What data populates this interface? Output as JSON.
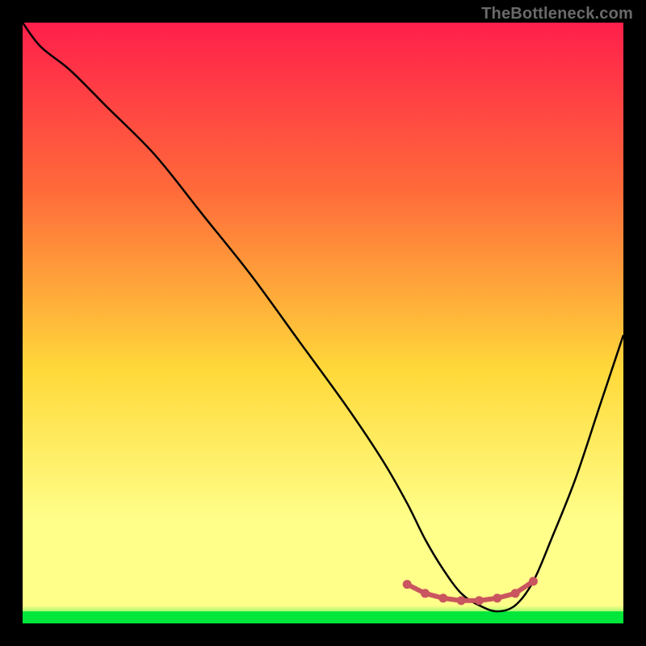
{
  "watermark": "TheBottleneck.com",
  "colors": {
    "background": "#000000",
    "gradient_top": "#ff1f4b",
    "gradient_mid_upper": "#ff6b3a",
    "gradient_mid": "#ffd93a",
    "gradient_mid_lower": "#ffff8a",
    "gradient_bottom": "#00e63b",
    "curve_stroke": "#000000",
    "marker_stroke": "#c9555e",
    "marker_fill": "#c9555e"
  },
  "chart_data": {
    "type": "line",
    "title": "",
    "xlabel": "",
    "ylabel": "",
    "xlim": [
      0,
      100
    ],
    "ylim": [
      0,
      100
    ],
    "main_curve": {
      "x": [
        0,
        3,
        8,
        14,
        22,
        30,
        38,
        46,
        54,
        60,
        64,
        67,
        70,
        73,
        76,
        79,
        82,
        85,
        88,
        92,
        96,
        100
      ],
      "y": [
        100,
        96,
        92,
        86,
        78,
        68,
        58,
        47,
        36,
        27,
        20,
        14,
        9,
        5,
        3,
        2,
        3,
        7,
        14,
        24,
        36,
        48
      ]
    },
    "markers": {
      "x": [
        64,
        67,
        70,
        73,
        76,
        79,
        82,
        85
      ],
      "y": [
        6.5,
        5.0,
        4.2,
        3.8,
        3.8,
        4.2,
        5.0,
        7.0
      ]
    },
    "bottom_band": {
      "y_min": 0,
      "y_max": 2
    }
  }
}
